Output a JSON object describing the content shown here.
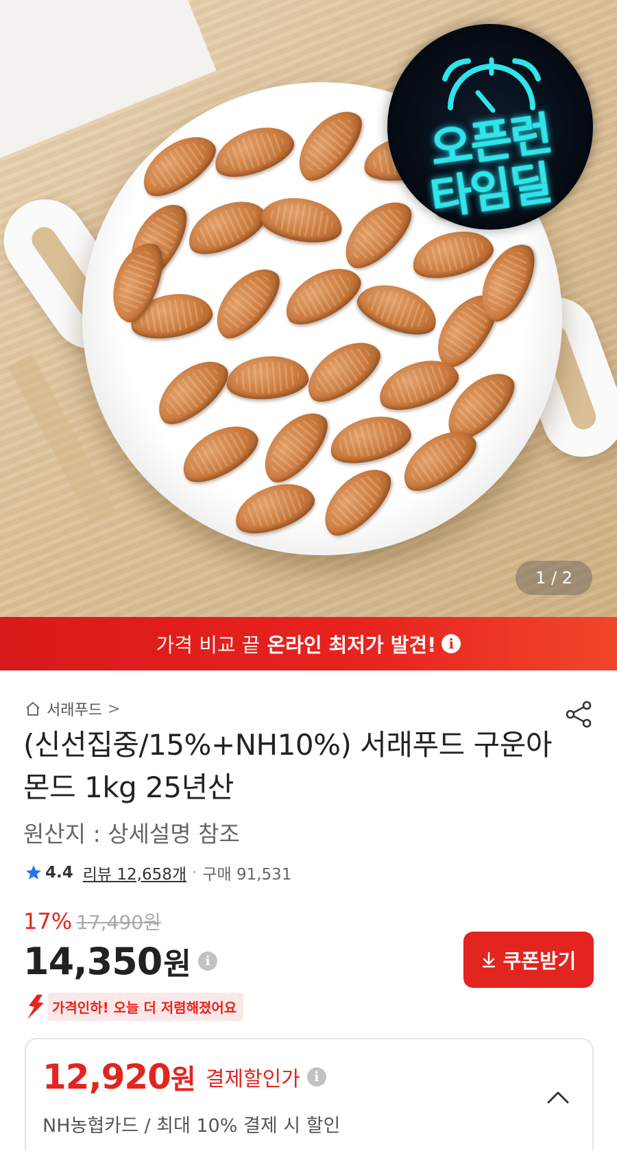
{
  "hero": {
    "badge_line1": "오픈런",
    "badge_line2": "타임딜",
    "pager": "1 / 2"
  },
  "banner": {
    "text_normal": "가격 비교 끝",
    "text_strong": "온라인 최저가 발견!",
    "info_glyph": "i"
  },
  "product": {
    "brand": "서래푸드",
    "brand_chevron": ">",
    "title": "(신선집중/15%+NH10%) 서래푸드 구운아몬드 1kg 25년산",
    "origin": "원산지 : 상세설명 참조",
    "rating": {
      "score": "4.4",
      "review": "리뷰 12,658개",
      "separator": "·",
      "purchase": "구매 91,531"
    },
    "discount_pct": "17%",
    "original_price": "17,490원",
    "price": "14,350",
    "price_unit": "원",
    "info_glyph": "i",
    "coupon_button": "쿠폰받기",
    "price_drop": "가격인하! 오늘 더 저렴해졌어요"
  },
  "payment_card": {
    "price": "12,920",
    "price_unit": "원",
    "label": "결제할인가",
    "info_glyph": "i",
    "subtitle": "NH농협카드 / 최대 10% 결제 시 할인"
  },
  "colors": {
    "accent_red": "#e3241f",
    "neon_cyan": "#2fe5e9"
  },
  "icons": [
    "home-icon",
    "share-icon",
    "star-icon",
    "download-icon",
    "chevron-up-icon",
    "alarm-clock-icon",
    "info-icon",
    "price-down-arrow-icon"
  ]
}
